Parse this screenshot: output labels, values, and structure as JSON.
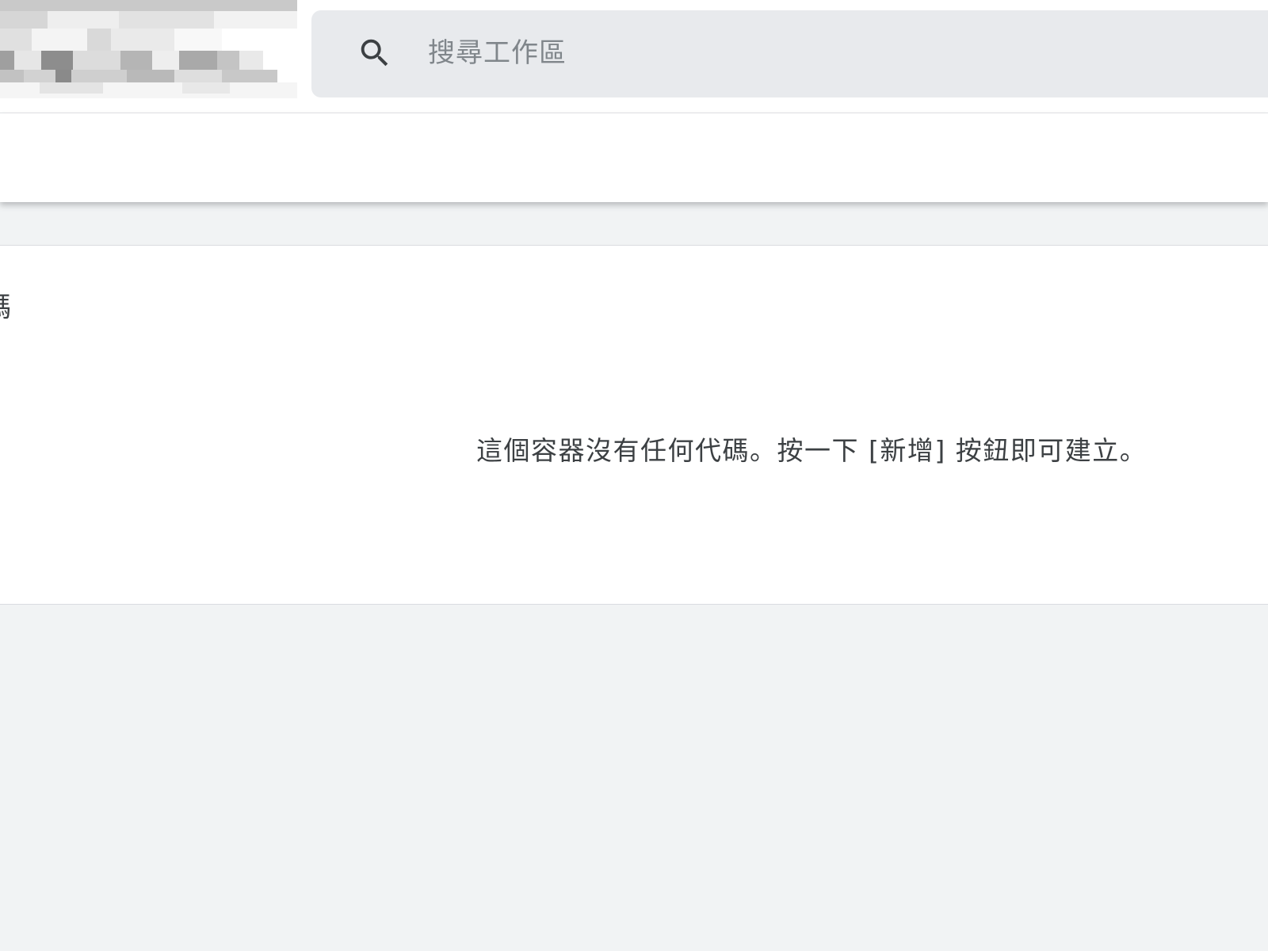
{
  "header": {
    "search": {
      "placeholder": "搜尋工作區",
      "value": ""
    }
  },
  "main": {
    "card": {
      "title_fragment": "碼",
      "empty_message": "這個容器沒有任何代碼。按一下 [新增] 按鈕即可建立。"
    }
  },
  "colors": {
    "page_background": "#f1f3f4",
    "search_background": "#e8eaed",
    "text": "#3c4043",
    "placeholder": "#80868b"
  }
}
